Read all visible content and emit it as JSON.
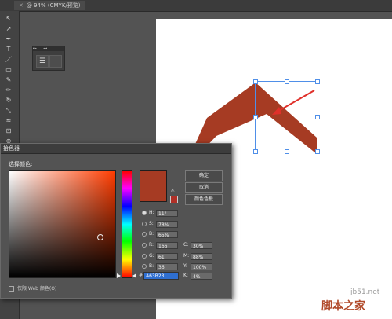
{
  "tab": {
    "title": "@ 94% (CMYK/预览)"
  },
  "canvas": {
    "shape_color": "#A63B23",
    "selection_color": "#4f8fe8",
    "arrow_color": "#e0302a"
  },
  "dialog": {
    "title": "拾色器",
    "select_label": "选择颜色:",
    "buttons": {
      "ok": "确定",
      "cancel": "取消",
      "swatches": "颜色色板"
    },
    "fields": [
      {
        "label": "H:",
        "value": "11°",
        "selected": true
      },
      {
        "label": "S:",
        "value": "78%",
        "selected": false
      },
      {
        "label": "B:",
        "value": "65%",
        "selected": false
      },
      {
        "label": "R:",
        "value": "166",
        "selected": false
      },
      {
        "label": "G:",
        "value": "61",
        "selected": false
      },
      {
        "label": "B:",
        "value": "36",
        "selected": false
      }
    ],
    "cmyk": [
      {
        "label": "C:",
        "value": "30%"
      },
      {
        "label": "M:",
        "value": "88%"
      },
      {
        "label": "Y:",
        "value": "100%"
      },
      {
        "label": "K:",
        "value": "4%"
      }
    ],
    "hex_label": "#",
    "hex_value": "A63B23",
    "web_only": "仅限 Web 颜色(O)",
    "current_color": "#A63B23"
  },
  "watermark": {
    "url": "jb51.net",
    "text": "脚本之家"
  }
}
